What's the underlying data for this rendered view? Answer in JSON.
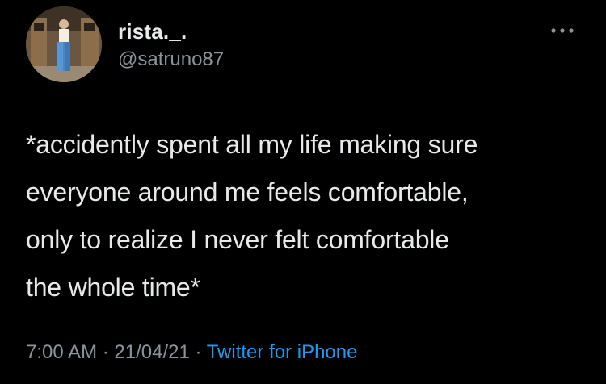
{
  "user": {
    "display_name": "rista._.",
    "handle": "@satruno87"
  },
  "tweet": {
    "text": "*accidently spent all my life making sure\neveryone around me feels comfortable,\nonly to realize I never felt comfortable\nthe whole time*",
    "time": "7:00 AM",
    "date": "21/04/21",
    "source": "Twitter for iPhone",
    "separator": " · "
  },
  "icons": {
    "more": "more-horizontal-icon",
    "avatar": "avatar"
  },
  "colors": {
    "background": "#000000",
    "text": "#e7e9ea",
    "secondary": "#8b949a",
    "link": "#1d9bf0"
  }
}
